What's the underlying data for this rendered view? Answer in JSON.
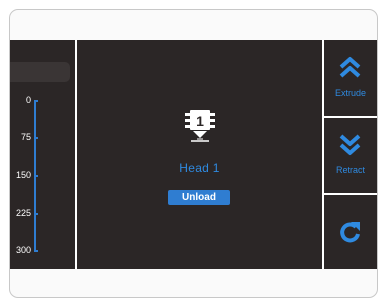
{
  "ruler": {
    "ticks": [
      "0",
      "75",
      "150",
      "225",
      "300"
    ]
  },
  "head": {
    "number": "1",
    "label": "Head 1",
    "unload_label": "Unload"
  },
  "actions": {
    "extrude_label": "Extrude",
    "retract_label": "Retract"
  },
  "colors": {
    "accent": "#2f7dd1",
    "background": "#2b2626"
  },
  "icons": {
    "extrude": "double-chevron-up-icon",
    "retract": "double-chevron-down-icon",
    "refresh": "refresh-icon",
    "head": "print-head-icon"
  }
}
